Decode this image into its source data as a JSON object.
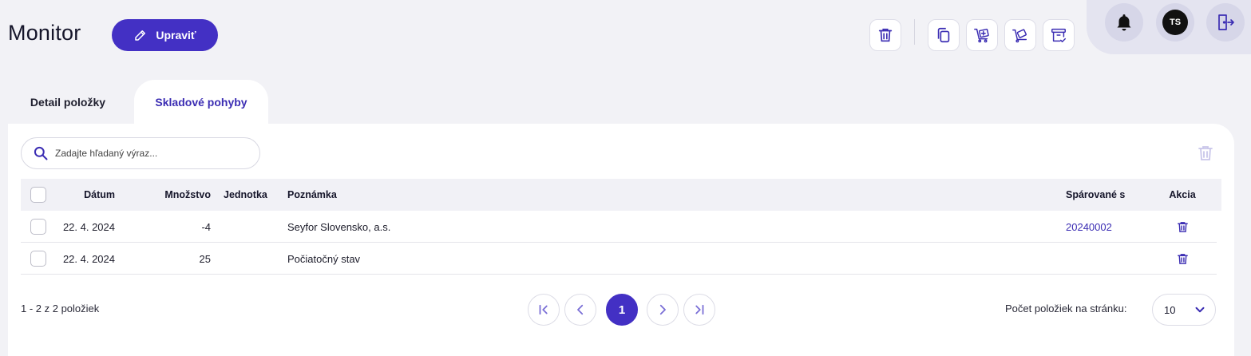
{
  "header": {
    "title": "Monitor",
    "edit_label": "Upraviť"
  },
  "toolbar": {
    "icons": [
      "trash-icon",
      "copy-icon",
      "box-plus-icon",
      "hand-truck-icon",
      "archive-check-icon"
    ]
  },
  "user": {
    "initials": "TS"
  },
  "tabs": [
    {
      "label": "Detail položky",
      "active": false
    },
    {
      "label": "Skladové pohyby",
      "active": true
    }
  ],
  "search": {
    "placeholder": "Zadajte hľadaný výraz...",
    "value": ""
  },
  "table": {
    "columns": {
      "date": "Dátum",
      "quantity": "Množstvo",
      "unit": "Jednotka",
      "note": "Poznámka",
      "paired": "Spárované s",
      "action": "Akcia"
    },
    "rows": [
      {
        "date": "22. 4. 2024",
        "quantity": "-4",
        "unit": "",
        "note": "Seyfor Slovensko, a.s.",
        "paired": "20240002"
      },
      {
        "date": "22. 4. 2024",
        "quantity": "25",
        "unit": "",
        "note": "Počiatočný stav",
        "paired": ""
      }
    ]
  },
  "pagination": {
    "summary": "1 - 2 z 2 položiek",
    "current_page": "1",
    "per_page_label": "Počet položiek na stránku:",
    "per_page_value": "10"
  },
  "colors": {
    "accent": "#4330c4",
    "link": "#3b2db3",
    "background": "#f2f2f6"
  }
}
